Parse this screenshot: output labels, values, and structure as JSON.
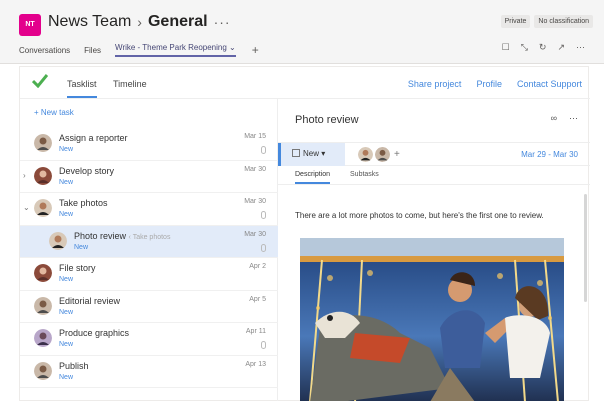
{
  "team": {
    "avatar_text": "NT",
    "name": "News Team",
    "channel": "General",
    "more": "···",
    "labels": [
      "Private",
      "No classification"
    ]
  },
  "tabs": [
    "Conversations",
    "Files",
    "Wrike - Theme Park Reopening"
  ],
  "colors": {
    "teams_accent": "#6264a7",
    "wrike_blue": "#4488dd",
    "status_new": "#4488dd",
    "selected_row": "#e2ebf9",
    "team_avatar": "#e3008c",
    "wrike_logo": "#4caf50"
  },
  "wrike": {
    "nav": {
      "tasklist": "Tasklist",
      "timeline": "Timeline",
      "links": [
        "Share project",
        "Profile",
        "Contact Support"
      ]
    },
    "new_task": "+ New task",
    "tasks": [
      {
        "title": "Assign a reporter",
        "status": "New",
        "date": "Mar 15"
      },
      {
        "title": "Develop story",
        "status": "New",
        "date": "Mar 30"
      },
      {
        "title": "Take photos",
        "status": "New",
        "date": "Mar 30"
      },
      {
        "title": "Photo review",
        "parent": "‹ Take photos",
        "status": "New",
        "date": "Mar 30"
      },
      {
        "title": "File story",
        "status": "New",
        "date": "Apr 2"
      },
      {
        "title": "Editorial review",
        "status": "New",
        "date": "Apr 5"
      },
      {
        "title": "Produce graphics",
        "status": "New",
        "date": "Apr 11"
      },
      {
        "title": "Publish",
        "status": "New",
        "date": "Apr 13"
      }
    ],
    "detail": {
      "title": "Photo review",
      "status": "New",
      "date_range": "Mar 29 - Mar 30",
      "tabs": [
        "Description",
        "Subtasks"
      ],
      "description": "There are a lot more photos to come, but here's the first one to review."
    }
  }
}
